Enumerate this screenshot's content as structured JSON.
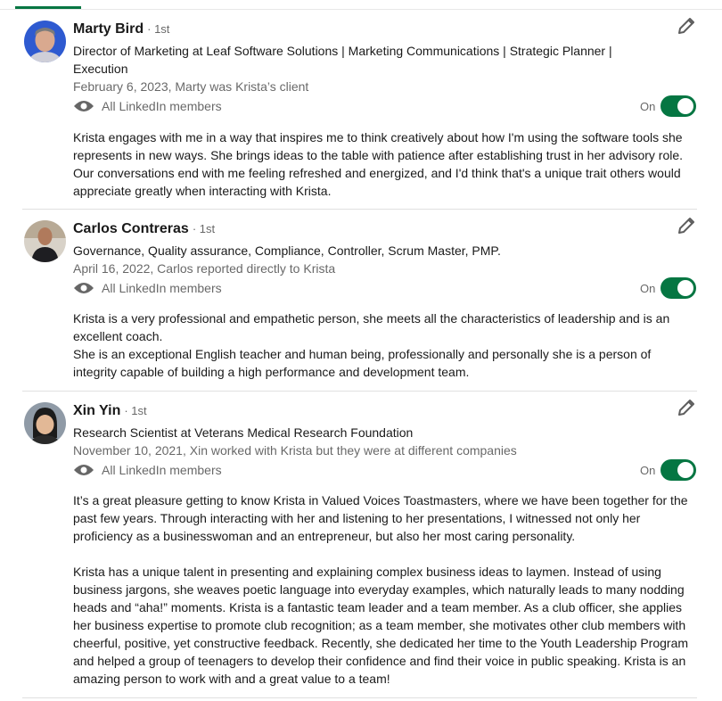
{
  "recommendations": [
    {
      "name": "Marty Bird",
      "degree": "· 1st",
      "headline": "Director of Marketing at Leaf Software Solutions | Marketing Communications | Strategic Planner | Execution",
      "meta": "February 6, 2023, Marty was Krista’s client",
      "visibility": "All LinkedIn members",
      "toggle_label": "On",
      "paragraphs": [
        "Krista engages with me in a way that inspires me to think creatively about how I'm using the software tools she represents in new ways. She brings ideas to the table with patience after establishing trust in her advisory role. Our conversations end with me feeling refreshed and energized, and I'd think that's a unique trait others would appreciate greatly when interacting with Krista."
      ]
    },
    {
      "name": "Carlos Contreras",
      "degree": "· 1st",
      "headline": "Governance, Quality assurance, Compliance, Controller, Scrum Master, PMP.",
      "meta": "April 16, 2022, Carlos reported directly to Krista",
      "visibility": "All LinkedIn members",
      "toggle_label": "On",
      "paragraphs": [
        "Krista is a very professional and empathetic person, she meets all the characteristics of leadership and is an excellent coach.",
        "She is an exceptional English teacher and human being, professionally and personally she is a person of integrity capable of building a high performance and development team."
      ]
    },
    {
      "name": "Xin Yin",
      "degree": "· 1st",
      "headline": "Research Scientist at Veterans Medical Research Foundation",
      "meta": "November 10, 2021, Xin worked with Krista but they were at different companies",
      "visibility": "All LinkedIn members",
      "toggle_label": "On",
      "paragraphs": [
        "It’s a great pleasure getting to know Krista in Valued Voices Toastmasters, where we have been together for the past few years. Through interacting with her and listening to her presentations, I witnessed not only her proficiency as a businesswoman and an entrepreneur, but also her most caring personality.",
        "Krista has a unique talent in presenting and explaining complex business ideas to laymen. Instead of using business jargons, she weaves poetic language into everyday examples, which naturally leads to many nodding heads and “aha!” moments. Krista is a fantastic team leader and a team member. As a club officer, she applies her business expertise to promote club recognition; as a team member, she motivates other club members with cheerful, positive, yet constructive feedback. Recently, she dedicated her time to the Youth Leadership Program and helped a group of teenagers to develop their confidence and find their voice in public speaking. Krista is an amazing person to work with and a great value to a team!"
      ]
    }
  ],
  "colors": {
    "toggle_on": "#057642",
    "tab_indicator": "#057642"
  }
}
